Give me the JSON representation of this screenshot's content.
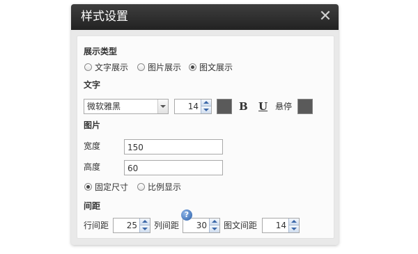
{
  "dialog": {
    "title": "样式设置",
    "close_symbol": "✕",
    "sections": {
      "display_type": "展示类型",
      "text": "文字",
      "image": "图片",
      "spacing": "间距"
    },
    "display_options": [
      {
        "label": "文字展示",
        "checked": false
      },
      {
        "label": "图片展示",
        "checked": false
      },
      {
        "label": "图文展示",
        "checked": true
      }
    ],
    "text_settings": {
      "font_family": "微软雅黑",
      "font_size": "14",
      "text_color": "#5a5a5a",
      "bold_label": "B",
      "underline_label": "U",
      "hover_label": "悬停",
      "hover_color": "#5a5a5a"
    },
    "image_settings": {
      "width_label": "宽度",
      "width_value": "150",
      "height_label": "高度",
      "height_value": "60",
      "size_options": [
        {
          "label": "固定尺寸",
          "checked": true
        },
        {
          "label": "比例显示",
          "checked": false
        }
      ],
      "help_label": "?"
    },
    "spacing_settings": {
      "row_label": "行间距",
      "row_value": "25",
      "col_label": "列间距",
      "col_value": "30",
      "img_text_label": "图文间距",
      "img_text_value": "14"
    },
    "colors": {
      "titlebar": "#2c2c2c",
      "spinner_arrow": "#3a67a8",
      "help_icon": "#2a5ea8"
    }
  }
}
